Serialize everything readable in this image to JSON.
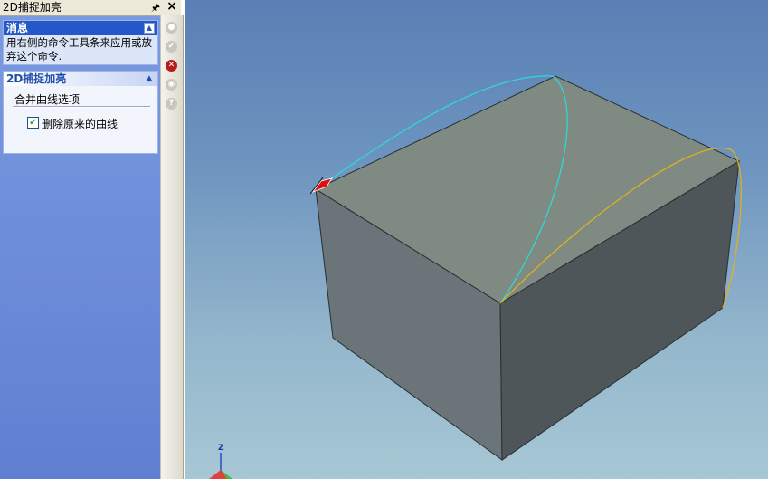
{
  "panel": {
    "title": "2D捕捉加亮",
    "pin_icon": "pin-icon",
    "close_icon": "close-icon"
  },
  "message_group": {
    "header": "消息",
    "text": "用右侧的命令工具条来应用或放弃这个命令."
  },
  "options_group": {
    "header": "2D捕捉加亮",
    "section_label": "合并曲线选项",
    "delete_original_label": "删除原来的曲线",
    "delete_original_checked": true
  },
  "toolbar": {
    "buttons": [
      "apply-icon",
      "ok-icon",
      "cancel-icon",
      "preview-icon",
      "help-icon"
    ]
  },
  "viewport": {
    "axis_label": "Z",
    "colors": {
      "box_top": "#7f8a83",
      "box_left": "#6b7579",
      "box_right": "#4f5659",
      "curve_cyan": "#2fd8d8",
      "curve_yellow": "#e0b020",
      "marker_red": "#e01010"
    }
  }
}
